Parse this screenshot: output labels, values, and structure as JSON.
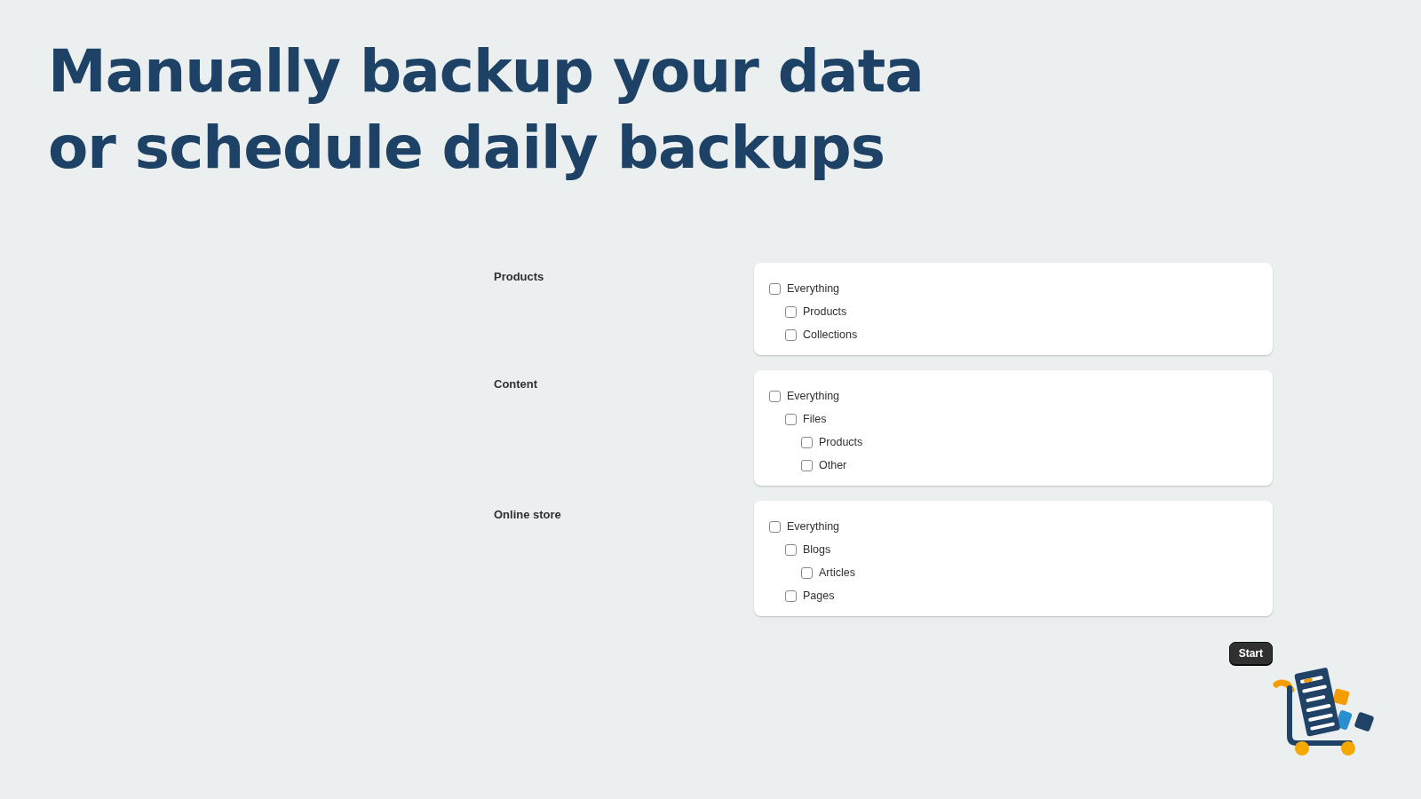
{
  "heading": "Manually backup your data or schedule daily backups",
  "sections": [
    {
      "label": "Products",
      "items": [
        {
          "label": "Everything",
          "checked": false,
          "children": [
            {
              "label": "Products",
              "checked": false
            },
            {
              "label": "Collections",
              "checked": false
            }
          ]
        }
      ]
    },
    {
      "label": "Content",
      "items": [
        {
          "label": "Everything",
          "checked": false,
          "children": [
            {
              "label": "Files",
              "checked": false,
              "children": [
                {
                  "label": "Products",
                  "checked": false
                },
                {
                  "label": "Other",
                  "checked": false
                }
              ]
            }
          ]
        }
      ]
    },
    {
      "label": "Online store",
      "items": [
        {
          "label": "Everything",
          "checked": false,
          "children": [
            {
              "label": "Blogs",
              "checked": false,
              "children": [
                {
                  "label": "Articles",
                  "checked": false
                }
              ]
            },
            {
              "label": "Pages",
              "checked": false
            }
          ]
        }
      ]
    }
  ],
  "start_button": "Start"
}
